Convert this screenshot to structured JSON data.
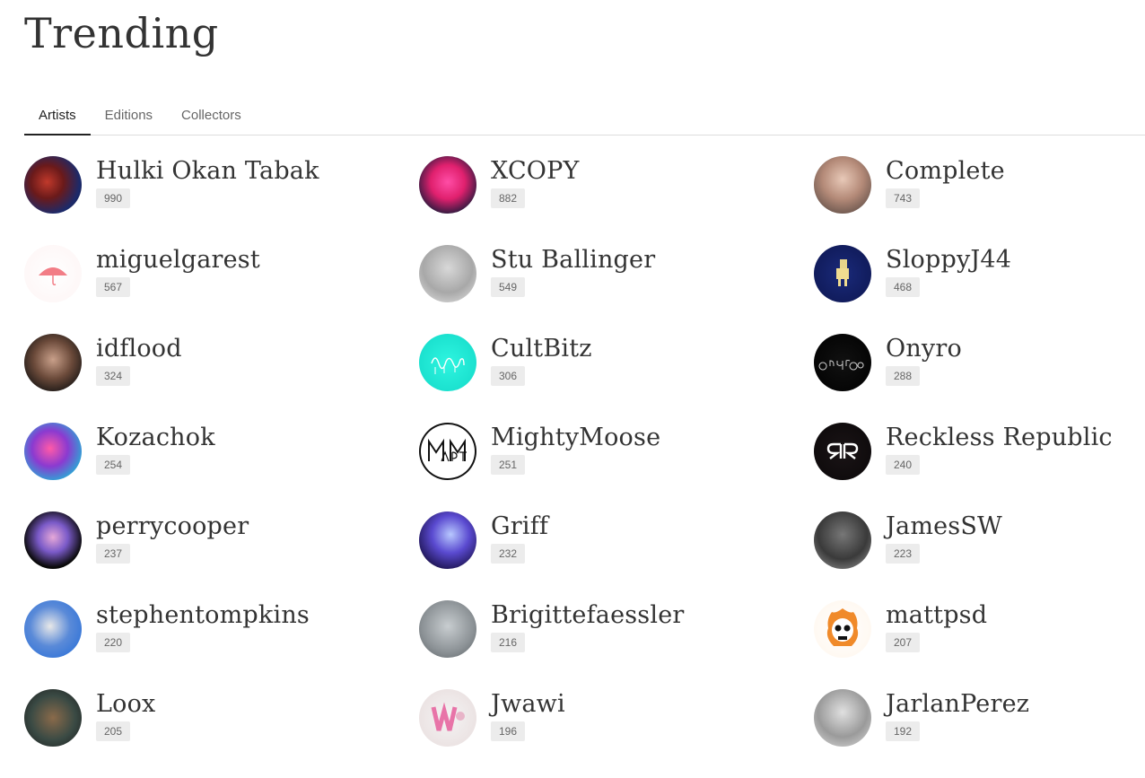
{
  "page": {
    "title": "Trending"
  },
  "tabs": [
    {
      "label": "Artists",
      "active": true
    },
    {
      "label": "Editions",
      "active": false
    },
    {
      "label": "Collectors",
      "active": false
    }
  ],
  "artists": [
    {
      "name": "Hulki Okan Tabak",
      "count": "990",
      "avatar_bg": "radial-gradient(circle at 40% 45%, #c0392b 0%, #6b1a1a 35%, #1b2a6b 70%, #0a0a20 100%)"
    },
    {
      "name": "XCOPY",
      "count": "882",
      "avatar_bg": "radial-gradient(circle at 50% 45%, #ff4da6 0%, #e0206e 40%, #1a1a3a 80%)"
    },
    {
      "name": "Complete",
      "count": "743",
      "avatar_bg": "radial-gradient(circle at 50% 40%, #e8c9b8 0%, #b48a78 45%, #5a4a44 90%)"
    },
    {
      "name": "miguelgarest",
      "count": "567",
      "avatar_bg": "radial-gradient(circle at 50% 50%, #ffffff 0%, #fdf4f4 100%)"
    },
    {
      "name": "Stu Ballinger",
      "count": "549",
      "avatar_bg": "radial-gradient(circle at 50% 40%, #d8d8d8 0%, #a8a8a8 55%, #e6e6e6 100%)"
    },
    {
      "name": "SloppyJ44",
      "count": "468",
      "avatar_bg": "radial-gradient(circle at 50% 50%, #1a2a7a 0%, #0d1650 100%)"
    },
    {
      "name": "idflood",
      "count": "324",
      "avatar_bg": "radial-gradient(circle at 50% 45%, #c9a08a 0%, #6b4a3a 45%, #111 85%)"
    },
    {
      "name": "CultBitz",
      "count": "306",
      "avatar_bg": "radial-gradient(circle at 50% 50%, #2ef5e0 0%, #13d9c8 100%)"
    },
    {
      "name": "Onyro",
      "count": "288",
      "avatar_bg": "radial-gradient(circle at 50% 50%, #111 0%, #000 100%)"
    },
    {
      "name": "Kozachok",
      "count": "254",
      "avatar_bg": "radial-gradient(circle at 45% 45%, #ff5aa8 0%, #8b3ad0 40%, #1fb5d6 80%)"
    },
    {
      "name": "MightyMoose",
      "count": "251",
      "avatar_bg": "radial-gradient(circle at 50% 50%, #ffffff 0%, #ffffff 100%)"
    },
    {
      "name": "Reckless Republic",
      "count": "240",
      "avatar_bg": "radial-gradient(circle at 50% 50%, #1a1416 0%, #0b0809 100%)"
    },
    {
      "name": "perrycooper",
      "count": "237",
      "avatar_bg": "radial-gradient(circle at 50% 45%, #e6a8d8 0%, #7a5ac8 35%, #0a0a0a 70%)"
    },
    {
      "name": "Griff",
      "count": "232",
      "avatar_bg": "radial-gradient(circle at 55% 40%, #b8c8ff 0%, #5a4ad0 40%, #120a3a 85%)"
    },
    {
      "name": "JamesSW",
      "count": "223",
      "avatar_bg": "radial-gradient(circle at 50% 40%, #777 0%, #3a3a3a 55%, #9a9a9a 100%)"
    },
    {
      "name": "stephentompkins",
      "count": "220",
      "avatar_bg": "radial-gradient(circle at 45% 45%, #e8e8e8 0%, #5a8ad8 45%, #1f6ad8 100%)"
    },
    {
      "name": "Brigittefaessler",
      "count": "216",
      "avatar_bg": "radial-gradient(circle at 50% 45%, #c8cdd0 0%, #8c9296 60%, #5a6064 100%)"
    },
    {
      "name": "mattpsd",
      "count": "207",
      "avatar_bg": "radial-gradient(circle at 50% 50%, #ffffff 0%, #fff6ec 100%)"
    },
    {
      "name": "Loox",
      "count": "205",
      "avatar_bg": "radial-gradient(circle at 50% 50%, #8a6a4a 0%, #3a4a44 55%, #1a1a1a 100%)"
    },
    {
      "name": "Jwawi",
      "count": "196",
      "avatar_bg": "radial-gradient(circle at 50% 50%, #f4f4f4 0%, #e8dcdc 100%)"
    },
    {
      "name": "JarlanPerez",
      "count": "192",
      "avatar_bg": "radial-gradient(circle at 50% 40%, #e0e0e0 0%, #9a9a9a 55%, #dcdcdc 100%)"
    }
  ]
}
